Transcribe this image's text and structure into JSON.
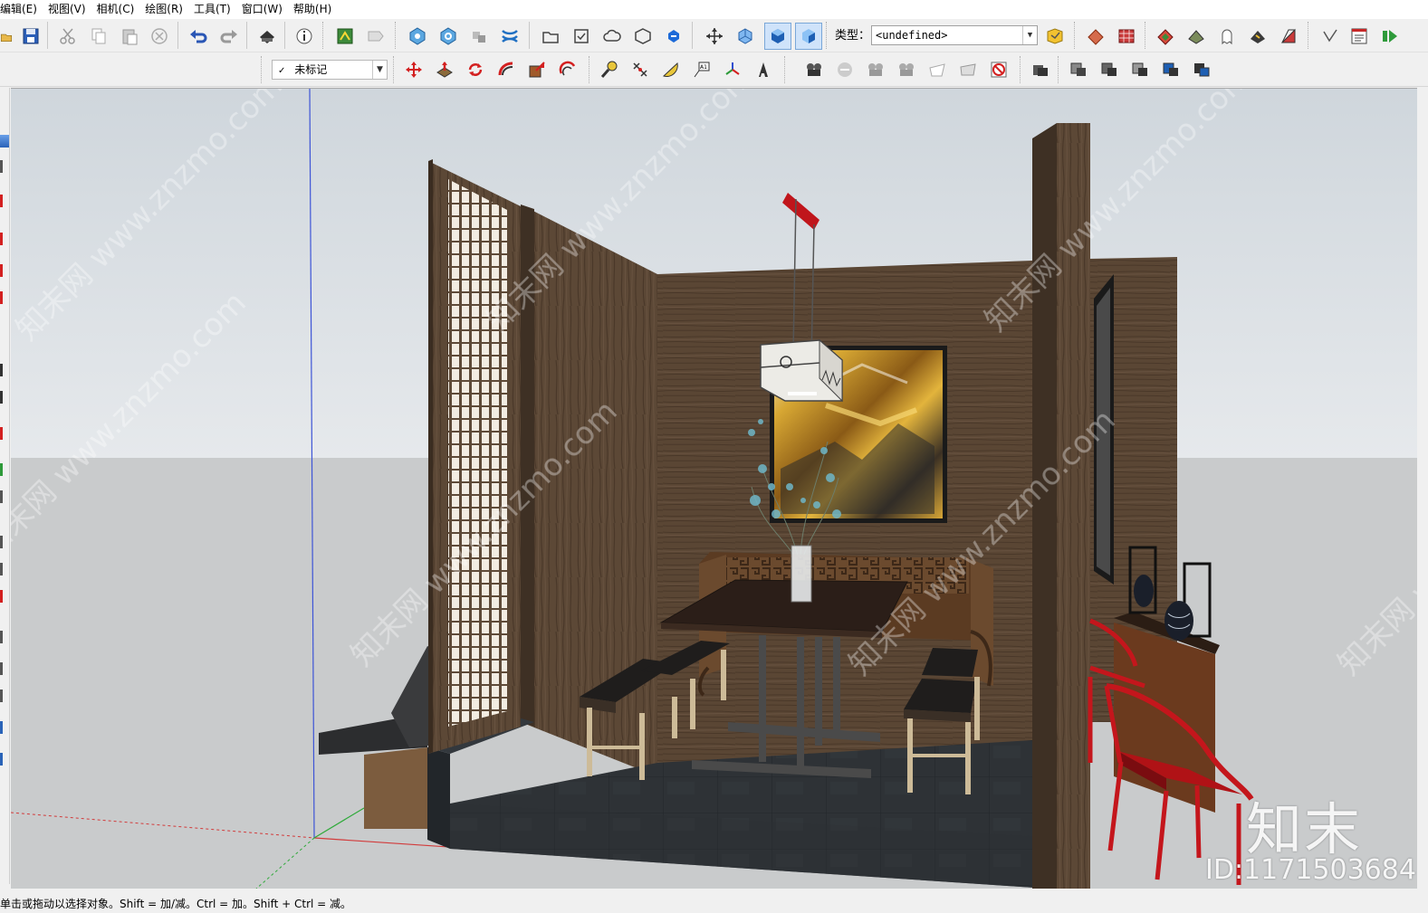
{
  "menu": [
    "编辑(E)",
    "视图(V)",
    "相机(C)",
    "绘图(R)",
    "工具(T)",
    "窗口(W)",
    "帮助(H)"
  ],
  "toolbar": {
    "type_label": "类型：",
    "type_value": "<undefined>",
    "tag_value": "未标记",
    "tag_check": "✓"
  },
  "status": {
    "hint": "单击或拖动以选择对象。Shift = 加/减。Ctrl = 加。Shift + Ctrl = 减。"
  },
  "watermark": {
    "brand": "知末",
    "id": "ID:1171503684",
    "site": "知末网 www.znzmo.com"
  },
  "icons": {
    "tb1": [
      "open-icon",
      "save-icon",
      "cut-icon",
      "copy-icon",
      "paste-icon",
      "erase-icon",
      "undo-icon",
      "redo-icon",
      "print-icon",
      "model-info-icon",
      "3d-warehouse-icon",
      "share-model-icon",
      "outer-shell-icon",
      "intersect-icon",
      "union-icon",
      "trim-icon",
      "folder-icon",
      "check-icon",
      "cloud-icon",
      "package-icon",
      "refresh-icon",
      "axes-icon",
      "iso-view-icon",
      "top-view-icon",
      "front-view-icon",
      "classifier-icon",
      "texture-icon",
      "material-icon",
      "terrain-icon",
      "profile-icon",
      "ghost-icon",
      "photo-icon",
      "section-icon",
      "measure-icon",
      "report-icon",
      "extension-icon"
    ],
    "tb2": [
      "move-icon",
      "push-pull-icon",
      "rotate-icon",
      "follow-me-icon",
      "scale-icon",
      "offset-icon",
      "tape-measure-icon",
      "dimension-icon",
      "protractor-icon",
      "text-icon",
      "axes-tool-icon",
      "3d-text-icon",
      "camera-icon",
      "orbit-icon",
      "walk-icon",
      "position-camera-icon",
      "look-around-icon",
      "section-plane-icon",
      "display-section-icon",
      "hide-section-icon",
      "solid-tools-icon",
      "shell-icon",
      "subtract-icon",
      "split-icon",
      "union-tool-icon"
    ]
  },
  "colors": {
    "sky": "#dce1e6",
    "ground": "#c9cbcc",
    "wall_wood": "#5a4634",
    "floor": "#2f3337",
    "chair_red": "#c4161c",
    "axis_blue": "#3d54d6",
    "axis_green": "#2faa3a",
    "axis_red": "#d23b3b",
    "painting_gold": "#c59a2a"
  }
}
